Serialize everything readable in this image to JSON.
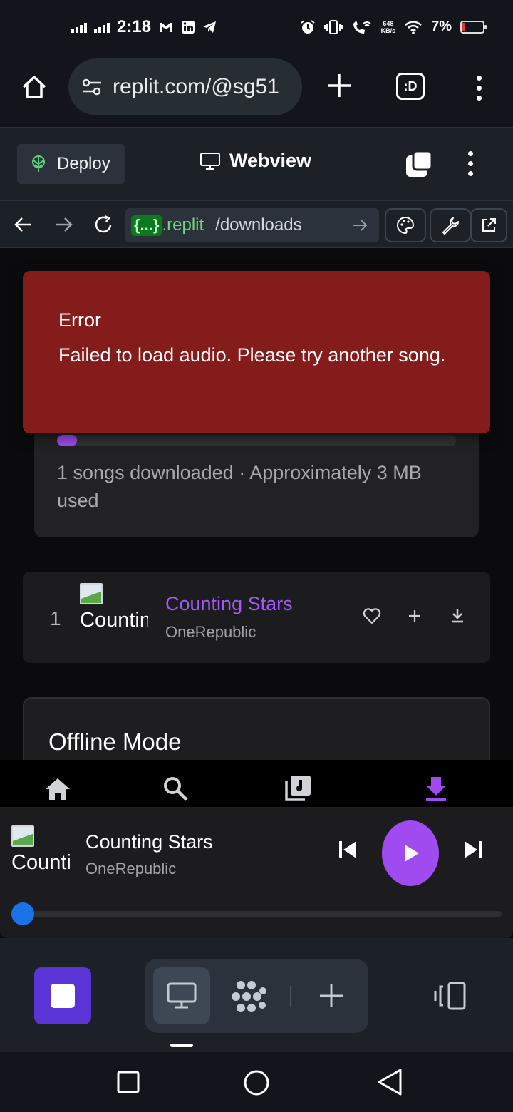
{
  "status_bar": {
    "time": "2:18",
    "network_speed": "648",
    "network_speed_unit": "KB/s",
    "battery": "7%",
    "battery_level": 0.07
  },
  "browser": {
    "url": "replit.com/@sg51",
    "icons": [
      "home-icon",
      "site-settings-icon",
      "plus-icon",
      "tab-switcher-icon",
      "menu-icon"
    ],
    "tab_label": ":D"
  },
  "replit_header": {
    "deploy_label": "Deploy",
    "title": "Webview"
  },
  "replit_nav": {
    "domain_badge": "{...}",
    "domain": ".replit",
    "path": "/downloads"
  },
  "error_toast": {
    "title": "Error",
    "message": "Failed to load audio. Please try another song."
  },
  "storage": {
    "summary": "1 songs downloaded · Approximately 3 MB used",
    "progress": 0.05
  },
  "songs": [
    {
      "index": "1",
      "thumb_alt": "Counting Stars",
      "title": "Counting Stars",
      "artist": "OneRepublic"
    }
  ],
  "offline": {
    "title": "Offline Mode"
  },
  "app_nav": {
    "items": [
      "home",
      "search",
      "library",
      "downloads"
    ],
    "active": "downloads",
    "accent": "#a04bf0"
  },
  "player": {
    "thumb_alt": "Counting Stars",
    "title": "Counting Stars",
    "artist": "OneRepublic",
    "progress": 0.0,
    "play_color": "#a04bf0",
    "progress_color": "#1a73e8"
  },
  "error_color": "#851c1c",
  "accent_title_color": "#a259f7"
}
